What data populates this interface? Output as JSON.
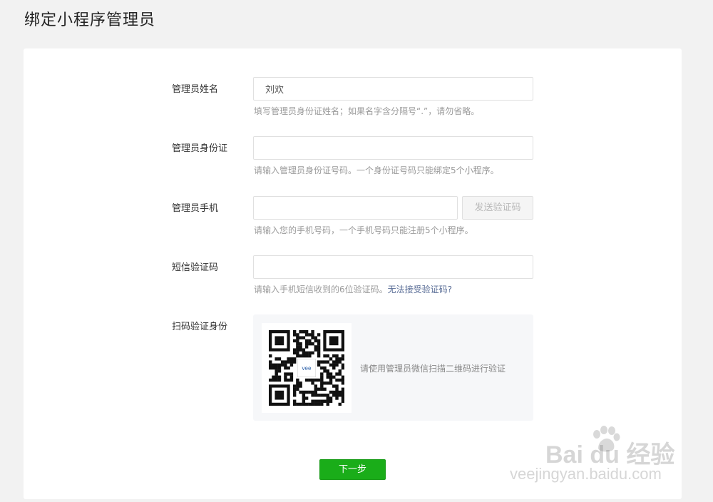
{
  "page": {
    "title": "绑定小程序管理员"
  },
  "form": {
    "name": {
      "label": "管理员姓名",
      "value": "刘欢",
      "tip": "填写管理员身份证姓名；如果名字含分隔号“.”，请勿省略。"
    },
    "id_card": {
      "label": "管理员身份证",
      "value": "",
      "tip": "请输入管理员身份证号码。一个身份证号码只能绑定5个小程序。"
    },
    "phone": {
      "label": "管理员手机",
      "value": "",
      "send_code_label": "发送验证码",
      "tip": "请输入您的手机号码，一个手机号码只能注册5个小程序。"
    },
    "sms_code": {
      "label": "短信验证码",
      "value": "",
      "tip": "请输入手机短信收到的6位验证码。",
      "help_link": "无法接受验证码?"
    },
    "qr_verify": {
      "label": "扫码验证身份",
      "hint": "请使用管理员微信扫描二维码进行验证",
      "logo_text": "vee"
    },
    "next_label": "下一步"
  },
  "watermark": {
    "brand": "Bai du 经验",
    "url": "jingyan.baidu.com",
    "prefix": "vee"
  },
  "colors": {
    "primary_green": "#1aad19",
    "link_blue": "#576b95",
    "tip_gray": "#9a9a9a"
  }
}
